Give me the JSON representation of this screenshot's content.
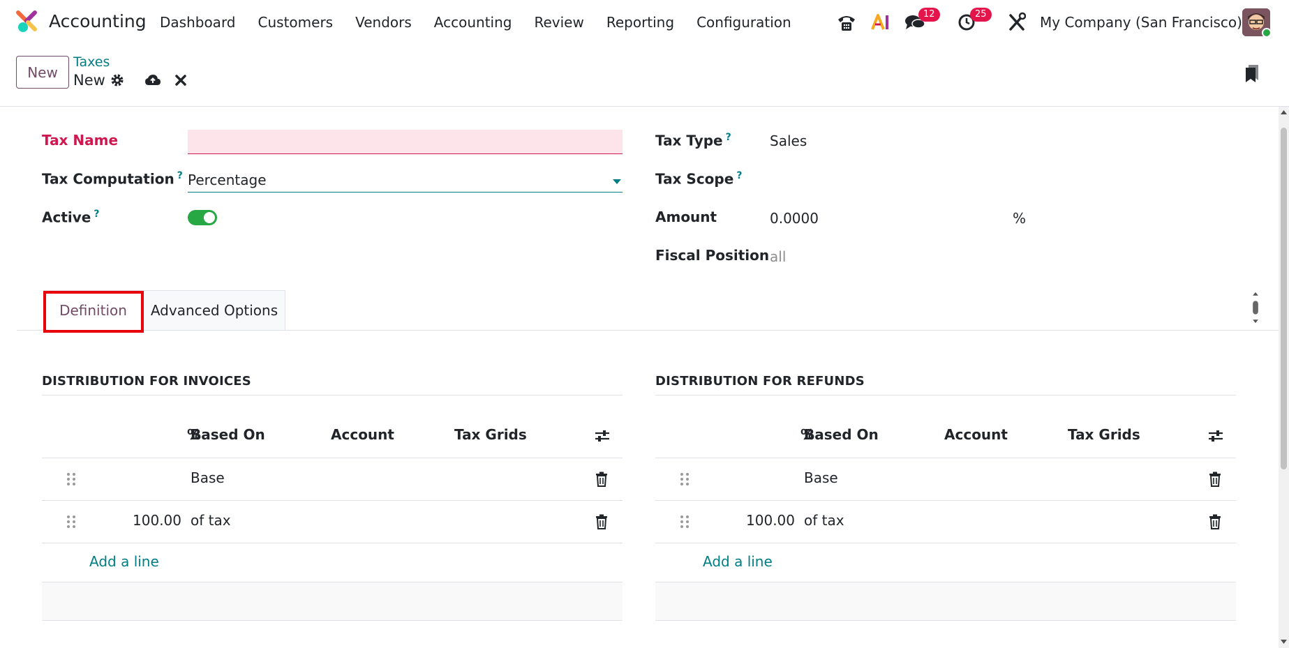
{
  "app": {
    "name": "Accounting",
    "menu": [
      "Dashboard",
      "Customers",
      "Vendors",
      "Accounting",
      "Review",
      "Reporting",
      "Configuration"
    ]
  },
  "systray": {
    "messages_count": "12",
    "activities_count": "25",
    "company": "My Company (San Francisco)"
  },
  "control": {
    "new_label": "New",
    "breadcrumb_parent": "Taxes",
    "breadcrumb_current": "New"
  },
  "form": {
    "tax_name_label": "Tax Name",
    "tax_name_value": "",
    "tax_computation_label": "Tax Computation",
    "tax_computation_value": "Percentage",
    "active_label": "Active",
    "active_value": true,
    "tax_type_label": "Tax Type",
    "tax_type_value": "Sales",
    "tax_scope_label": "Tax Scope",
    "tax_scope_value": "",
    "amount_label": "Amount",
    "amount_value": "0.0000",
    "amount_unit": "%",
    "fiscal_position_label": "Fiscal Position",
    "fiscal_position_value": "all",
    "help_mark": "?"
  },
  "tabs": [
    {
      "label": "Definition",
      "active": true
    },
    {
      "label": "Advanced Options",
      "active": false
    }
  ],
  "distribution": {
    "columns": [
      "%",
      "Based On",
      "Account",
      "Tax Grids"
    ],
    "add_line_label": "Add a line",
    "invoices": {
      "title": "DISTRIBUTION FOR INVOICES",
      "rows": [
        {
          "percent": "",
          "based_on": "Base",
          "account": "",
          "tax_grids": ""
        },
        {
          "percent": "100.00",
          "based_on": "of tax",
          "account": "",
          "tax_grids": ""
        }
      ]
    },
    "refunds": {
      "title": "DISTRIBUTION FOR REFUNDS",
      "rows": [
        {
          "percent": "",
          "based_on": "Base",
          "account": "",
          "tax_grids": ""
        },
        {
          "percent": "100.00",
          "based_on": "of tax",
          "account": "",
          "tax_grids": ""
        }
      ]
    }
  },
  "colors": {
    "brand": "#714b67",
    "link": "#017e84",
    "required": "#d0174f",
    "badge": "#e4154b",
    "toggle_on": "#28a745",
    "highlight": "#e8000b"
  },
  "icons": [
    "app-logo-icon",
    "phone-icon",
    "ai-icon",
    "chat-icon",
    "clock-icon",
    "tools-icon",
    "gear-icon",
    "cloud-upload-icon",
    "close-icon",
    "bookmark-icon",
    "drag-handle-icon",
    "trash-icon",
    "column-settings-icon"
  ]
}
